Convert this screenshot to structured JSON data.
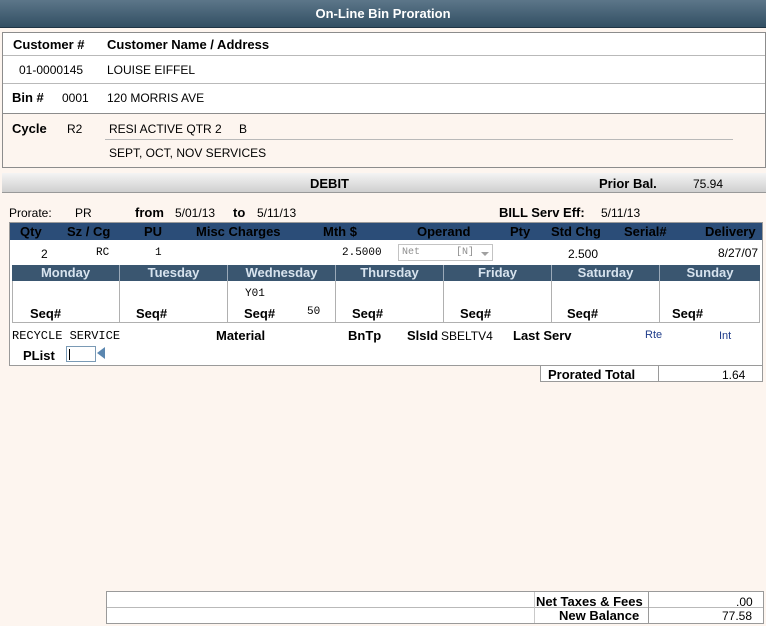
{
  "window": {
    "title": "On-Line Bin Proration"
  },
  "customer": {
    "number_label": "Customer #",
    "name_label": "Customer Name / Address",
    "number": "01-0000145",
    "name": "LOUISE EIFFEL"
  },
  "bin": {
    "label": "Bin #",
    "number": "0001",
    "address": "120 MORRIS AVE"
  },
  "cycle": {
    "label": "Cycle",
    "code": "R2",
    "description": "RESI ACTIVE QTR 2",
    "flag": "B",
    "services": "SEPT, OCT, NOV SERVICES"
  },
  "debit": {
    "label": "DEBIT",
    "prior_bal_label": "Prior Bal.",
    "prior_bal": "75.94"
  },
  "prorate": {
    "label": "Prorate:",
    "code": "PR",
    "from_label": "from",
    "from": "5/01/13",
    "to_label": "to",
    "to": "5/11/13",
    "bill_label": "BILL Serv Eff:",
    "bill_date": "5/11/13"
  },
  "columns": [
    "Qty",
    "Sz / Cg",
    "PU",
    "Misc Charges",
    "Mth $",
    "Operand",
    "Pty",
    "Std Chg",
    "Serial#",
    "Delivery"
  ],
  "row": {
    "qty": "2",
    "sz_cg": "RC",
    "pu": "1",
    "mth": "2.5000",
    "operand": "Net",
    "operand_code": "[N]",
    "std_chg": "2.500",
    "delivery": "8/27/07"
  },
  "schedule": {
    "seq_label": "Seq#",
    "days": [
      {
        "name": "Monday",
        "route": "",
        "seq": ""
      },
      {
        "name": "Tuesday",
        "route": "",
        "seq": ""
      },
      {
        "name": "Wednesday",
        "route": "Y01",
        "seq": "50"
      },
      {
        "name": "Thursday",
        "route": "",
        "seq": ""
      },
      {
        "name": "Friday",
        "route": "",
        "seq": ""
      },
      {
        "name": "Saturday",
        "route": "",
        "seq": ""
      },
      {
        "name": "Sunday",
        "route": "",
        "seq": ""
      }
    ]
  },
  "service": {
    "name": "RECYCLE SERVICE",
    "material_label": "Material",
    "bntp_label": "BnTp",
    "slsld_label": "SlsId",
    "slsld": "SBELTV4",
    "last_serv_label": "Last Serv",
    "rte": "Rte",
    "int": "Int",
    "plist_label": "PList"
  },
  "totals": {
    "prorated_label": "Prorated Total",
    "prorated": "1.64",
    "net_taxes_label": "Net Taxes & Fees",
    "net_taxes": ".00",
    "new_balance_label": "New Balance",
    "new_balance": "77.58"
  }
}
